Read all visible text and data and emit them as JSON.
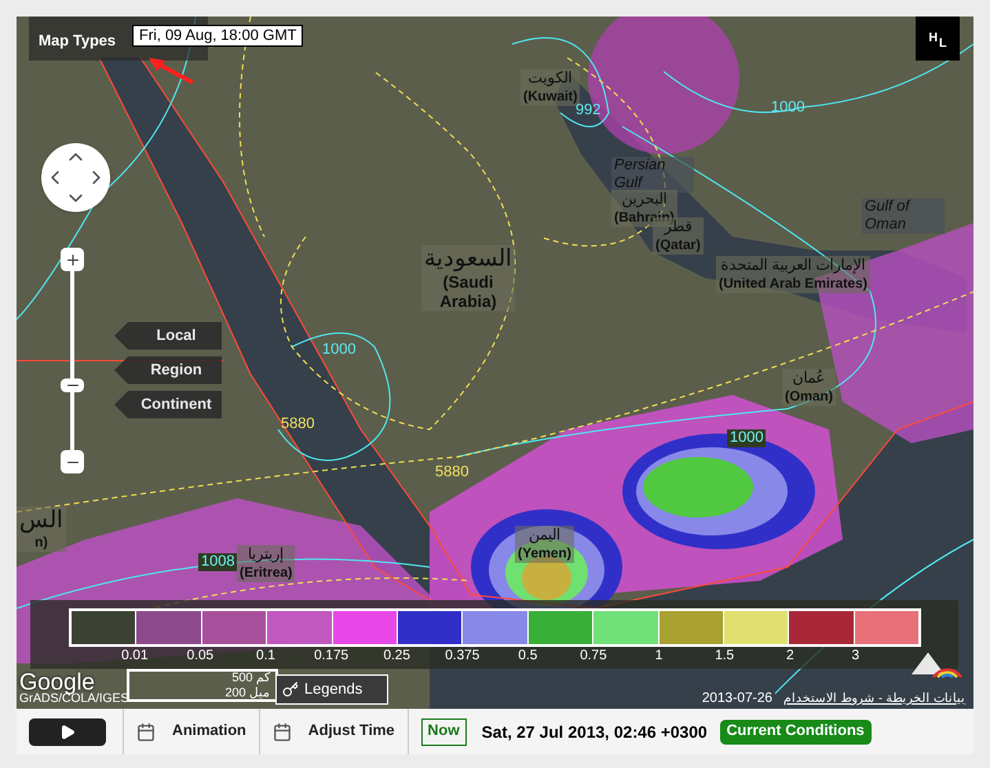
{
  "map": {
    "map_types_label": "Map Types",
    "time_label": "Fri, 09 Aug, 18:00 GMT",
    "pressure_toggle": [
      "H",
      "L"
    ],
    "scale_buttons": [
      "Local",
      "Region",
      "Continent"
    ],
    "place_labels": [
      {
        "text": "الكويت",
        "sub": "(Kuwait)"
      },
      {
        "text": "Persian Gulf",
        "kind": "sea"
      },
      {
        "text": "البحرين",
        "sub": "(Bahrain)"
      },
      {
        "text": "Gulf of Oman",
        "kind": "sea"
      },
      {
        "text": "السعودية",
        "sub": "(Saudi Arabia)"
      },
      {
        "text": "قطر",
        "sub": "(Qatar)"
      },
      {
        "text": "الإمارات العربية المتحدة",
        "sub": "(United Arab Emirates)"
      },
      {
        "text": "عُمان",
        "sub": "(Oman)"
      },
      {
        "text": "اليمن",
        "sub": "(Yemen)"
      },
      {
        "text": "إريتريا",
        "sub": "(Eritrea)"
      },
      {
        "text": "الس",
        "sub": "n)"
      }
    ],
    "contour_labels": [
      {
        "text": "992",
        "kind": "cyan"
      },
      {
        "text": "1000",
        "kind": "cyan"
      },
      {
        "text": "1000",
        "kind": "cyan"
      },
      {
        "text": "5880",
        "kind": "yellow"
      },
      {
        "text": "5880",
        "kind": "yellow"
      },
      {
        "text": "1000",
        "kind": "boxed"
      },
      {
        "text": "1008",
        "kind": "boxed"
      }
    ],
    "legend": {
      "swatches": [
        {
          "color": "#3c4233"
        },
        {
          "color": "#8c4a8c"
        },
        {
          "color": "#a8509c"
        },
        {
          "color": "#c058c0"
        },
        {
          "color": "#e848e8"
        },
        {
          "color": "#3030c8"
        },
        {
          "color": "#8888e8"
        },
        {
          "color": "#38b038"
        },
        {
          "color": "#70e078"
        },
        {
          "color": "#a8a030"
        },
        {
          "color": "#e0e070"
        },
        {
          "color": "#a82838"
        },
        {
          "color": "#e87078"
        }
      ],
      "labels": [
        "0.01",
        "0.05",
        "0.1",
        "0.175",
        "0.25",
        "0.375",
        "0.5",
        "0.75",
        "1",
        "1.5",
        "2",
        "3"
      ]
    },
    "logo": "Google",
    "credit": "GrADS/COLA/IGES",
    "scale": [
      "500 كم",
      "200 ميل"
    ],
    "legends_button": "Legends",
    "map_date": "2013-07-26",
    "terms": "بيانات الخريطة - شروط الاستخدام"
  },
  "toolbar": {
    "animation": "Animation",
    "adjust_time": "Adjust Time",
    "now": "Now",
    "datetime": "Sat, 27 Jul 2013, 02:46 +0300",
    "current_conditions": "Current Conditions"
  }
}
